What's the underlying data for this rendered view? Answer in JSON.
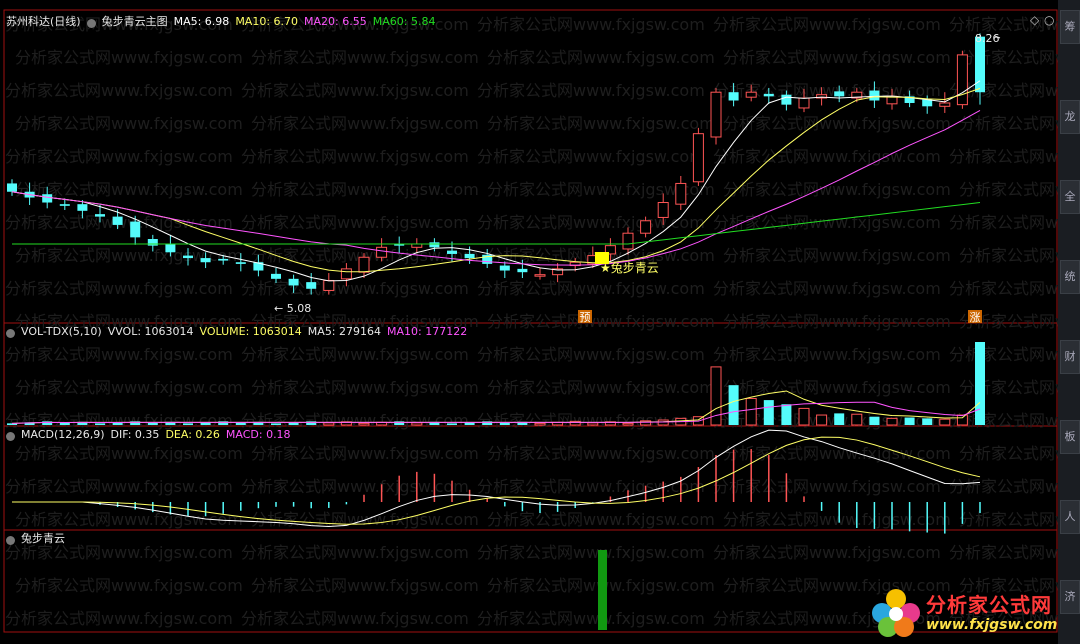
{
  "main": {
    "stock_name": "苏州科达(日线)",
    "indicator_name": "兔步青云主图",
    "ma5": "MA5: 6.98",
    "ma10": "MA10: 6.70",
    "ma20": "MA20: 6.55",
    "ma60": "MA60: 5.84",
    "high_label": "8.26",
    "low_label": "5.08",
    "signal_label": "★兔步青云",
    "marker_pre": "预",
    "marker_up": "涨"
  },
  "volume": {
    "name": "VOL-TDX(5,10)",
    "vvol": "VVOL: 1063014",
    "vol": "VOLUME: 1063014",
    "ma5": "MA5: 279164",
    "ma10": "MA10: 177122"
  },
  "macd": {
    "name": "MACD(12,26,9)",
    "dif": "DIF: 0.35",
    "dea": "DEA: 0.26",
    "macd": "MACD: 0.18"
  },
  "sub": {
    "name": "兔步青云"
  },
  "watermark": "分析家公式网www.fxjgsw.com",
  "logo": {
    "title": "分析家公式网",
    "url": "www.fxjgsw.com"
  },
  "side_tabs": [
    "筹",
    "龙",
    "全",
    "统",
    "财",
    "板",
    "人",
    "济"
  ],
  "colors": {
    "up": "#ff5555",
    "down": "#54fcfc",
    "ma5": "#ffffff",
    "ma10": "#ffff66",
    "ma20": "#ff55ff",
    "ma60": "#22dd22",
    "border": "#a01010"
  }
}
